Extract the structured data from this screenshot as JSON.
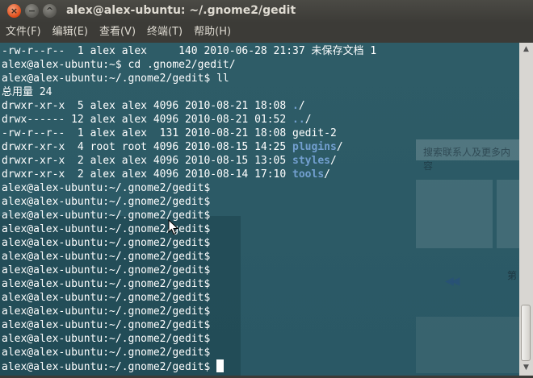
{
  "window": {
    "title": "alex@alex-ubuntu: ~/.gnome2/gedit",
    "close_icon": "×",
    "minimize_icon": "−",
    "maximize_icon": "^"
  },
  "menu": [
    {
      "label": "文件(F)"
    },
    {
      "label": "编辑(E)"
    },
    {
      "label": "查看(V)"
    },
    {
      "label": "终端(T)"
    },
    {
      "label": "帮助(H)"
    }
  ],
  "terminal": {
    "lines": [
      {
        "text": "-rw-r--r--  1 alex alex     140 2010-06-28 21:37 未保存文档 1"
      },
      {
        "text": "alex@alex-ubuntu:~$ cd .gnome2/gedit/"
      },
      {
        "text": "alex@alex-ubuntu:~/.gnome2/gedit$ ll"
      },
      {
        "text": "总用量 24"
      },
      {
        "prefix": "drwxr-xr-x  5 alex alex 4096 2010-08-21 18:08 ",
        "name": ".",
        "suffix": "/"
      },
      {
        "prefix": "drwx------ 12 alex alex 4096 2010-08-21 01:52 ",
        "name": "..",
        "suffix": "/"
      },
      {
        "text": "-rw-r--r--  1 alex alex  131 2010-08-21 18:08 gedit-2"
      },
      {
        "prefix": "drwxr-xr-x  4 root root 4096 2010-08-15 14:25 ",
        "name": "plugins",
        "suffix": "/"
      },
      {
        "prefix": "drwxr-xr-x  2 alex alex 4096 2010-08-15 13:05 ",
        "name": "styles",
        "suffix": "/"
      },
      {
        "prefix": "drwxr-xr-x  2 alex alex 4096 2010-08-14 17:10 ",
        "name": "tools",
        "suffix": "/"
      },
      {
        "text": "alex@alex-ubuntu:~/.gnome2/gedit$"
      },
      {
        "text": "alex@alex-ubuntu:~/.gnome2/gedit$"
      },
      {
        "text": "alex@alex-ubuntu:~/.gnome2/gedit$"
      },
      {
        "text": "alex@alex-ubuntu:~/.gnome2/gedit$"
      },
      {
        "text": "alex@alex-ubuntu:~/.gnome2/gedit$"
      },
      {
        "text": "alex@alex-ubuntu:~/.gnome2/gedit$"
      },
      {
        "text": "alex@alex-ubuntu:~/.gnome2/gedit$"
      },
      {
        "text": "alex@alex-ubuntu:~/.gnome2/gedit$"
      },
      {
        "text": "alex@alex-ubuntu:~/.gnome2/gedit$"
      },
      {
        "text": "alex@alex-ubuntu:~/.gnome2/gedit$"
      },
      {
        "text": "alex@alex-ubuntu:~/.gnome2/gedit$"
      },
      {
        "text": "alex@alex-ubuntu:~/.gnome2/gedit$"
      },
      {
        "text": "alex@alex-ubuntu:~/.gnome2/gedit$"
      },
      {
        "text": "alex@alex-ubuntu:~/.gnome2/gedit$"
      }
    ],
    "directory_color": "#729fcf",
    "background_color": "#2c5a66",
    "text_color": "#ffffff"
  },
  "background_ghost": {
    "search_text": "搜索联系人及更多内容",
    "side_label": "第"
  },
  "colors": {
    "titlebar": "#3c3b37",
    "close_button": "#df4a16"
  }
}
